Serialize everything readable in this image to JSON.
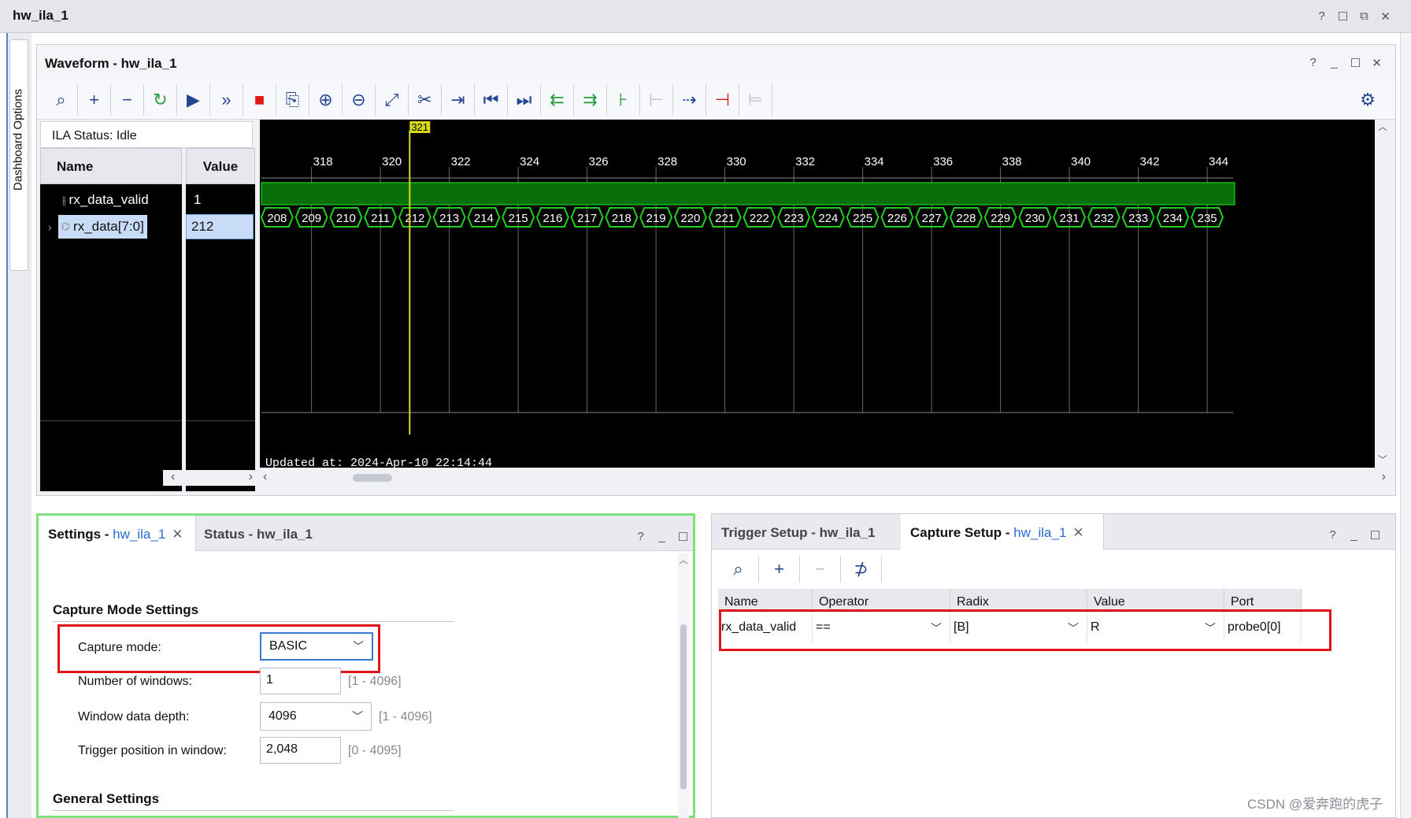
{
  "window": {
    "title": "hw_ila_1"
  },
  "dashboard_tab": {
    "label": "Dashboard Options"
  },
  "waveform": {
    "title": "Waveform - hw_ila_1",
    "ila_status": "ILA Status:  Idle",
    "columns": {
      "name": "Name",
      "value": "Value"
    },
    "signals": [
      {
        "name": "rx_data_valid",
        "value": "1"
      },
      {
        "name": "rx_data[7:0]",
        "value": "212"
      }
    ],
    "cursor_label": "321",
    "ticks": [
      "318",
      "320",
      "322",
      "324",
      "326",
      "328",
      "330",
      "332",
      "334",
      "336",
      "338",
      "340",
      "342",
      "344"
    ],
    "bus_values": [
      "208",
      "209",
      "210",
      "211",
      "212",
      "213",
      "214",
      "215",
      "216",
      "217",
      "218",
      "219",
      "220",
      "221",
      "222",
      "223",
      "224",
      "225",
      "226",
      "227",
      "228",
      "229",
      "230",
      "231",
      "232",
      "233",
      "234",
      "235"
    ],
    "updated": "Updated at: 2024-Apr-10 22:14:44",
    "colors": {
      "wave_green": "#1fd11f",
      "cursor_yellow": "#d8d81a",
      "background": "#000000"
    }
  },
  "settings": {
    "tab_prefix": "Settings - ",
    "tab_link": "hw_ila_1",
    "tab2": "Status - hw_ila_1",
    "capture_mode_section": "Capture Mode Settings",
    "capture_mode_label": "Capture mode:",
    "capture_mode_value": "BASIC",
    "num_windows_label": "Number of windows:",
    "num_windows_value": "1",
    "num_windows_hint": "[1 - 4096]",
    "window_depth_label": "Window data depth:",
    "window_depth_value": "4096",
    "window_depth_hint": "[1 - 4096]",
    "trigger_pos_label": "Trigger position in window:",
    "trigger_pos_value": "2,048",
    "trigger_pos_hint": "[0 - 4095]",
    "general_section": "General Settings"
  },
  "capture": {
    "tab1": "Trigger Setup - hw_ila_1",
    "tab2_prefix": "Capture Setup - ",
    "tab2_link": "hw_ila_1",
    "columns": [
      "Name",
      "Operator",
      "Radix",
      "Value",
      "Port"
    ],
    "row": {
      "name": "rx_data_valid",
      "operator": "==",
      "radix": "[B]",
      "value": "R",
      "port": "probe0[0]"
    }
  },
  "watermark": "CSDN @爱奔跑的虎子"
}
